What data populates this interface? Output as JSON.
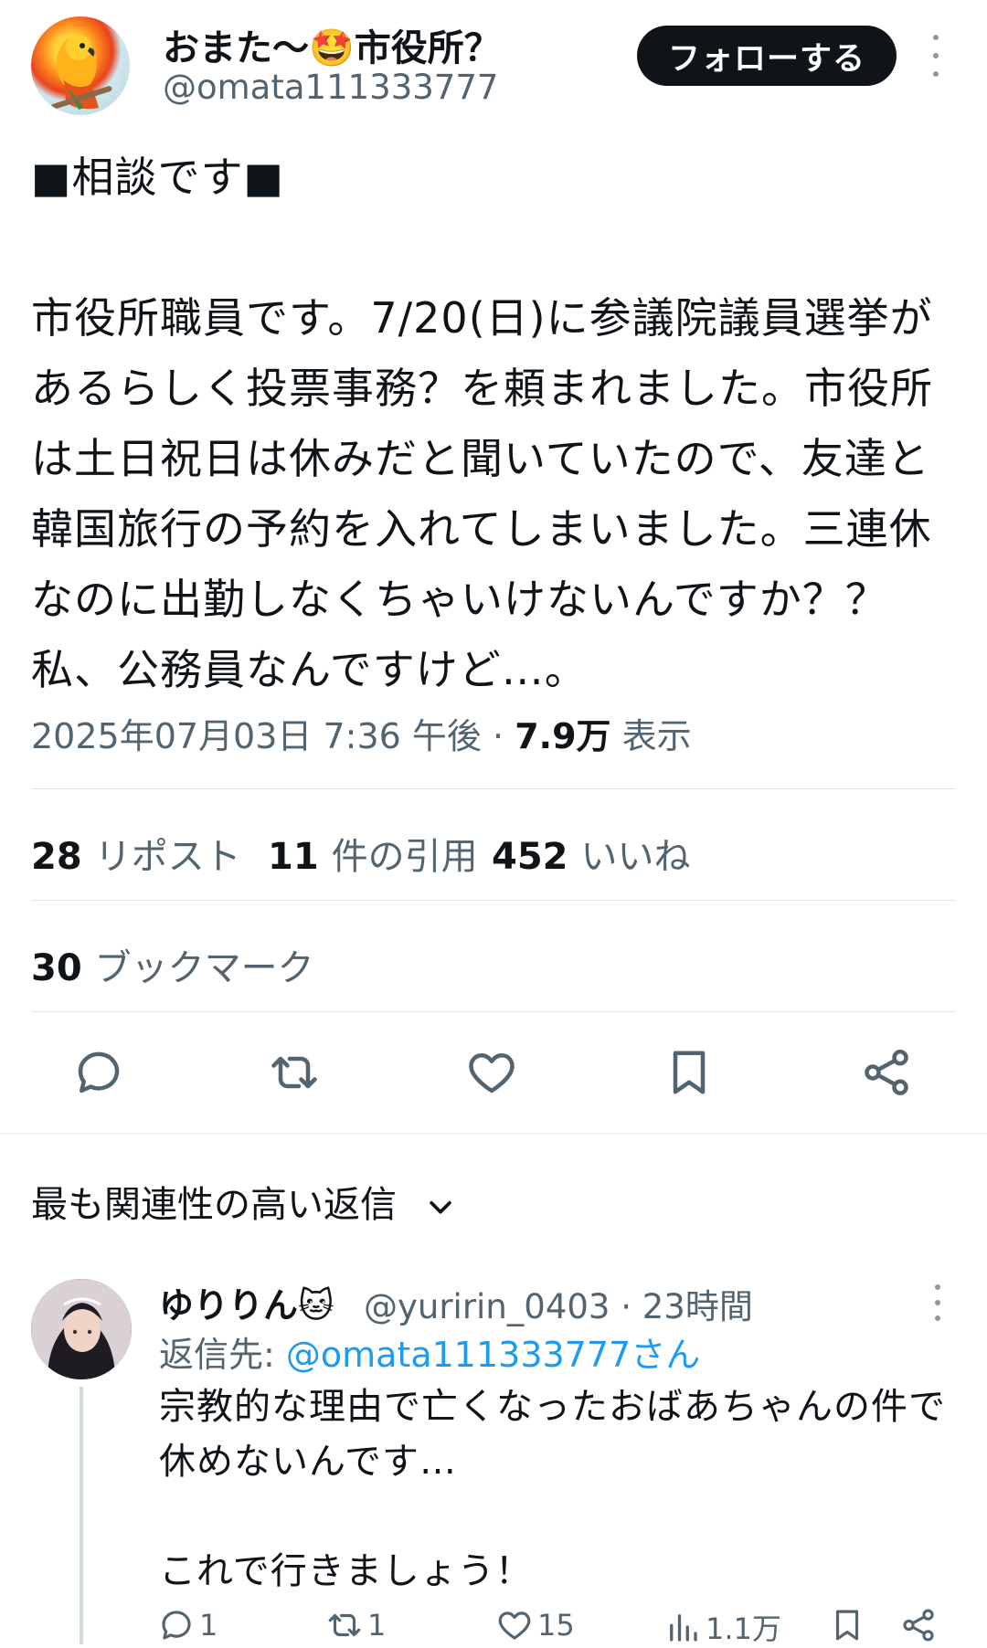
{
  "tweet": {
    "author": {
      "display_name": "おまた〜🤩市役所？",
      "handle": "@omata111333777"
    },
    "follow_label": "フォローする",
    "text": "■相談です■\n\n市役所職員です。7/20(日)に参議院議員選挙があるらしく投票事務？を頼まれました。市役所は土日祝日は休みだと聞いていたので、友達と韓国旅行の予約を入れてしまいました。三連休なのに出勤しなくちゃいけないんですか？？私、公務員なんですけど…。",
    "timestamp": "2025年07月03日 7:36 午後",
    "separator": "·",
    "views_count": "7.9万",
    "views_label": "表示",
    "stats": {
      "reposts_count": "28",
      "reposts_label": "リポスト",
      "quotes_count": "11",
      "quotes_label": "件の引用",
      "likes_count": "452",
      "likes_label": "いいね",
      "bookmarks_count": "30",
      "bookmarks_label": "ブックマーク"
    },
    "icons": [
      "reply-icon",
      "repost-icon",
      "like-icon",
      "bookmark-icon",
      "share-icon"
    ]
  },
  "replies_section": {
    "label": "最も関連性の高い返信",
    "chevron": "chevron-down-icon"
  },
  "reply": {
    "display_name": "ゆりりん🐱",
    "handle": "@yuririn_0403",
    "separator": "·",
    "time": "23時間",
    "reply_to_prefix": "返信先: ",
    "reply_to_handle": "@omata111333777さん",
    "text": "宗教的な理由で亡くなったおばあちゃんの件で休めないんです…\n\nこれで行きましょう！",
    "actions": {
      "replies": "1",
      "reposts": "1",
      "likes": "15",
      "views": "1.1万"
    }
  },
  "colors": {
    "text": "#0f1419",
    "secondary": "#536471",
    "link": "#1d9bf0",
    "divider": "#e1e6ea",
    "follow_bg": "#0f1419"
  }
}
